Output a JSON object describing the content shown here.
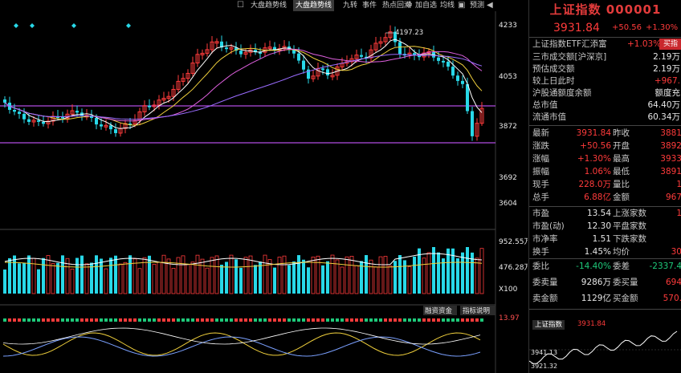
{
  "toolbar": {
    "tabs": [
      "大盘趋势线",
      "大盘趋势线",
      "九转",
      "事件",
      "热点回溯",
      "加自选",
      "均线",
      "预测"
    ],
    "active_index": 1
  },
  "chart": {
    "price_axis_labels": [
      "4233",
      "4053",
      "3872",
      "3692",
      "3604"
    ],
    "high_marker": "4197.23",
    "volume_axis_labels": [
      "952.55万",
      "476.28万",
      "X100"
    ],
    "indicator_buttons": [
      "融资资金",
      "指标说明"
    ],
    "indicator_axis_labels": [
      "13.97",
      "3941.13",
      "3921.32"
    ],
    "mini_label": "上证指数",
    "mini_value": "3931.84",
    "colors": {
      "up": "#ff3b3b",
      "down": "#28d8e8",
      "ma5": "#ffffff",
      "ma10": "#f0d03c",
      "ma20": "#e060e0",
      "ma60": "#9a6cff",
      "hline": "#b04be0"
    }
  },
  "sidebar": {
    "title": "上证指数 000001",
    "price": "3931.84",
    "change": "+50.56",
    "change_pct": "+1.30%",
    "etf": {
      "name": "上证指数ETF汇添富",
      "pct": "+1.03%",
      "buy_label": "买指"
    },
    "info": [
      {
        "label": "三市成交额[沪深京]",
        "value": "2.19万"
      },
      {
        "label": "预估成交额",
        "value": "2.19万"
      },
      {
        "label": "较上日此时",
        "value": "+967."
      },
      {
        "label": "沪股通额度余额",
        "value": "额度充"
      },
      {
        "label": "总市值",
        "value": "64.40万"
      },
      {
        "label": "流通市值",
        "value": "60.34万"
      }
    ],
    "quote": [
      {
        "l1": "最新",
        "v1": "3931.84",
        "l2": "昨收",
        "v2": "3881"
      },
      {
        "l1": "涨跌",
        "v1": "+50.56",
        "l2": "开盘",
        "v2": "3892"
      },
      {
        "l1": "涨幅",
        "v1": "+1.30%",
        "l2": "最高",
        "v2": "3933"
      },
      {
        "l1": "振幅",
        "v1": "1.06%",
        "l2": "最低",
        "v2": "3891"
      },
      {
        "l1": "现手",
        "v1": "228.0万",
        "l2": "量比",
        "v2": "1"
      },
      {
        "l1": "总手",
        "v1": "6.88亿",
        "l2": "金额",
        "v2": "967"
      }
    ],
    "valuation": [
      {
        "l1": "市盈",
        "v1": "13.54",
        "l2": "上涨家数",
        "v2": "1"
      },
      {
        "l1": "市盈(动)",
        "v1": "12.30",
        "l2": "平盘家数",
        "v2": ""
      },
      {
        "l1": "市净率",
        "v1": "1.51",
        "l2": "下跌家数",
        "v2": ""
      },
      {
        "l1": "换手",
        "v1": "1.45%",
        "l2": "均价",
        "v2": "30"
      }
    ],
    "order": [
      {
        "l1": "委比",
        "v1": "-14.40%",
        "l2": "委差",
        "v2": "-2337.4"
      },
      {
        "l1": "委卖量",
        "v1": "9286万",
        "l2": "委买量",
        "v2": "694"
      },
      {
        "l1": "卖金额",
        "v1": "1129亿",
        "l2": "买金额",
        "v2": "570."
      }
    ]
  }
}
